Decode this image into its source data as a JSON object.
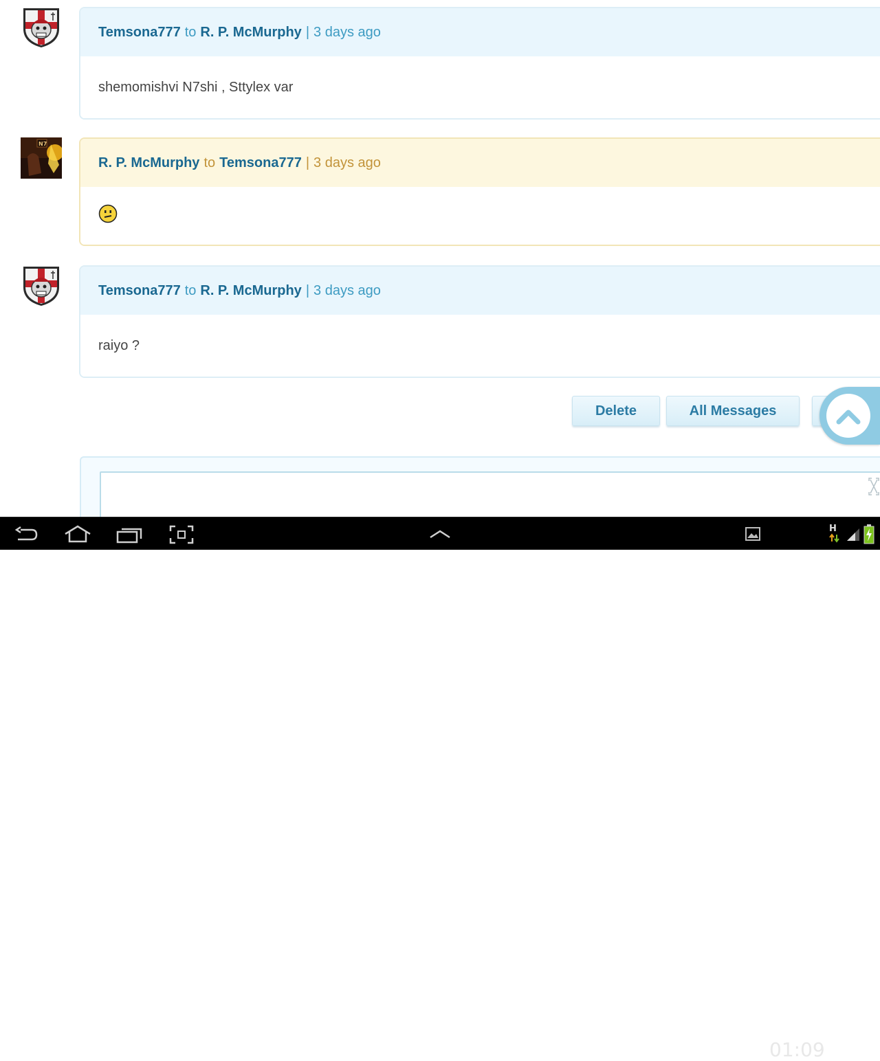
{
  "messages": [
    {
      "from": "Temsona777",
      "to_word": "to",
      "to": "R. P. McMurphy",
      "sep": "|",
      "time": "3 days ago",
      "text": "shemomishvi N7shi , Sttylex var"
    },
    {
      "from": "R. P. McMurphy",
      "to_word": "to",
      "to": "Temsona777",
      "sep": "|",
      "time": "3 days ago",
      "emoji": "confused-smiley-icon"
    },
    {
      "from": "Temsona777",
      "to_word": "to",
      "to": "R. P. McMurphy",
      "sep": "|",
      "time": "3 days ago",
      "text": "raiyo ?"
    }
  ],
  "actions": {
    "delete": "Delete",
    "all_messages": "All Messages"
  },
  "statusbar": {
    "time": "01:09",
    "network": "H"
  },
  "colors": {
    "accent": "#1a6891",
    "blue_header": "#e9f6fd",
    "yellow_header": "#fdf7df",
    "time_blue": "#3d9bc2",
    "time_gold": "#c29339"
  }
}
